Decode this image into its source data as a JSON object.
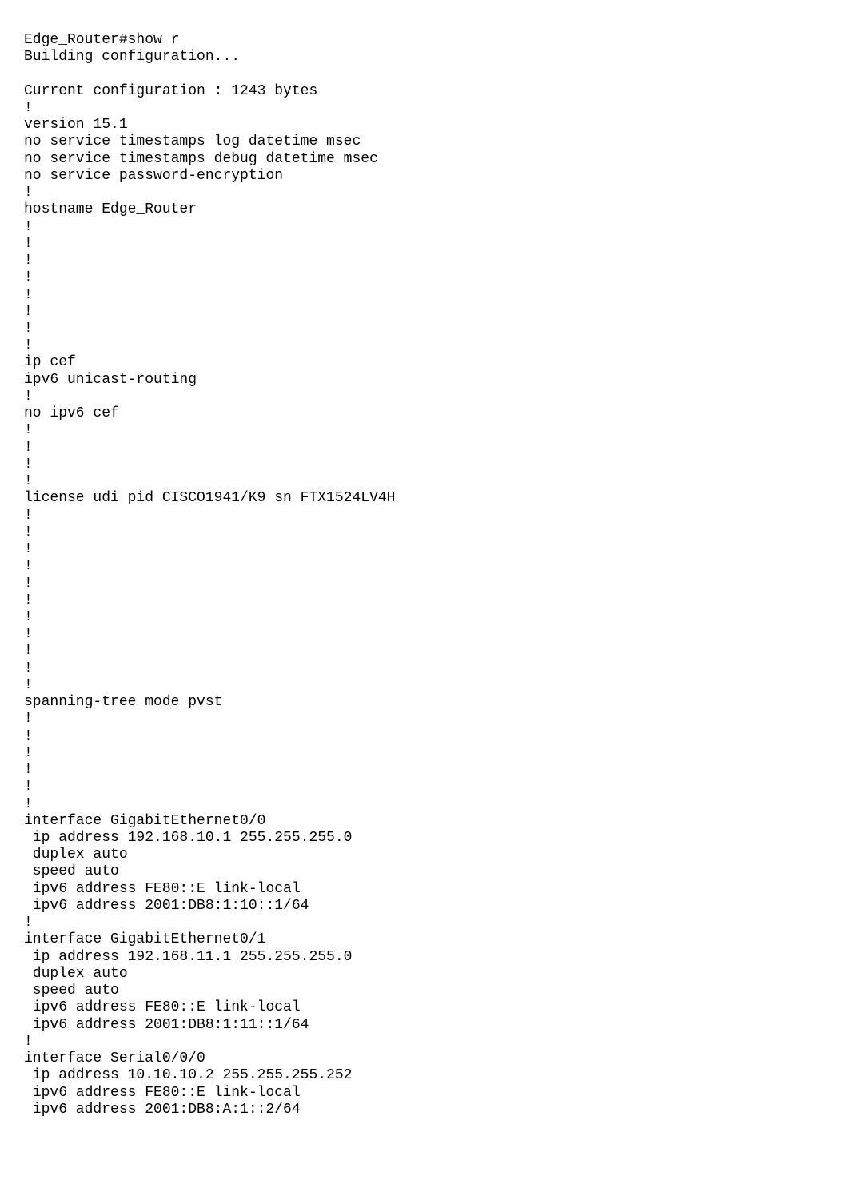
{
  "config": {
    "prompt": "Edge_Router#show r",
    "building": "Building configuration...",
    "blank1": "",
    "current": "Current configuration : 1243 bytes",
    "bang1": "!",
    "version": "version 15.1",
    "svc1": "no service timestamps log datetime msec",
    "svc2": "no service timestamps debug datetime msec",
    "svc3": "no service password-encryption",
    "bang2": "!",
    "hostname": "hostname Edge_Router",
    "bang3": "!",
    "bang4": "!",
    "bang5": "!",
    "bang6": "!",
    "bang7": "!",
    "bang8": "!",
    "bang9": "!",
    "bang10": "!",
    "ipcef": "ip cef",
    "ipv6u": "ipv6 unicast-routing",
    "bang11": "!",
    "noipv6cef": "no ipv6 cef",
    "bang12": "!",
    "bang13": "!",
    "bang14": "!",
    "bang15": "!",
    "license": "license udi pid CISCO1941/K9 sn FTX1524LV4H",
    "bang16": "!",
    "bang17": "!",
    "bang18": "!",
    "bang19": "!",
    "bang20": "!",
    "bang21": "!",
    "bang22": "!",
    "bang23": "!",
    "bang24": "!",
    "bang25": "!",
    "bang26": "!",
    "stp": "spanning-tree mode pvst",
    "bang27": "!",
    "bang28": "!",
    "bang29": "!",
    "bang30": "!",
    "bang31": "!",
    "bang32": "!",
    "ifg00": "interface GigabitEthernet0/0",
    "g00_ip": " ip address 192.168.10.1 255.255.255.0",
    "g00_duplex": " duplex auto",
    "g00_speed": " speed auto",
    "g00_ipv6ll": " ipv6 address FE80::E link-local",
    "g00_ipv6": " ipv6 address 2001:DB8:1:10::1/64",
    "bang33": "!",
    "ifg01": "interface GigabitEthernet0/1",
    "g01_ip": " ip address 192.168.11.1 255.255.255.0",
    "g01_duplex": " duplex auto",
    "g01_speed": " speed auto",
    "g01_ipv6ll": " ipv6 address FE80::E link-local",
    "g01_ipv6": " ipv6 address 2001:DB8:1:11::1/64",
    "bang34": "!",
    "ifs000": "interface Serial0/0/0",
    "s000_ip": " ip address 10.10.10.2 255.255.255.252",
    "s000_ipv6ll": " ipv6 address FE80::E link-local",
    "s000_ipv6": " ipv6 address 2001:DB8:A:1::2/64"
  }
}
